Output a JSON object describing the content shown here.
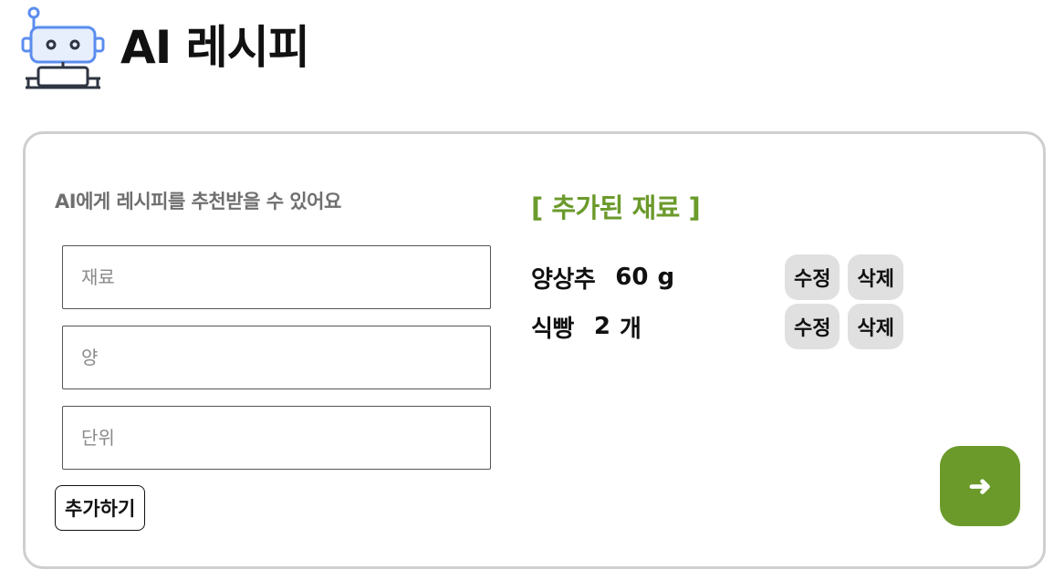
{
  "app": {
    "title": "AI 레시피",
    "logo_icon": "robot-icon"
  },
  "form": {
    "subtitle": "AI에게 레시피를 추천받을 수 있어요",
    "ingredient_placeholder": "재료",
    "amount_placeholder": "양",
    "unit_placeholder": "단위",
    "add_label": "추가하기"
  },
  "ingredients": {
    "title": "[ 추가된 재료 ]",
    "items": [
      {
        "name": "양상추",
        "amount": "60",
        "unit": "g",
        "edit_label": "수정",
        "delete_label": "삭제"
      },
      {
        "name": "식빵",
        "amount": "2",
        "unit": "개",
        "edit_label": "수정",
        "delete_label": "삭제"
      }
    ]
  },
  "next": {
    "icon": "arrow-right-icon",
    "glyph": "➜"
  },
  "colors": {
    "accent": "#6b9a2b",
    "card_border": "#cfcfcf",
    "pill_bg": "#e0e0e0",
    "robot_blue": "#5b8def",
    "robot_dark": "#2f3542"
  }
}
